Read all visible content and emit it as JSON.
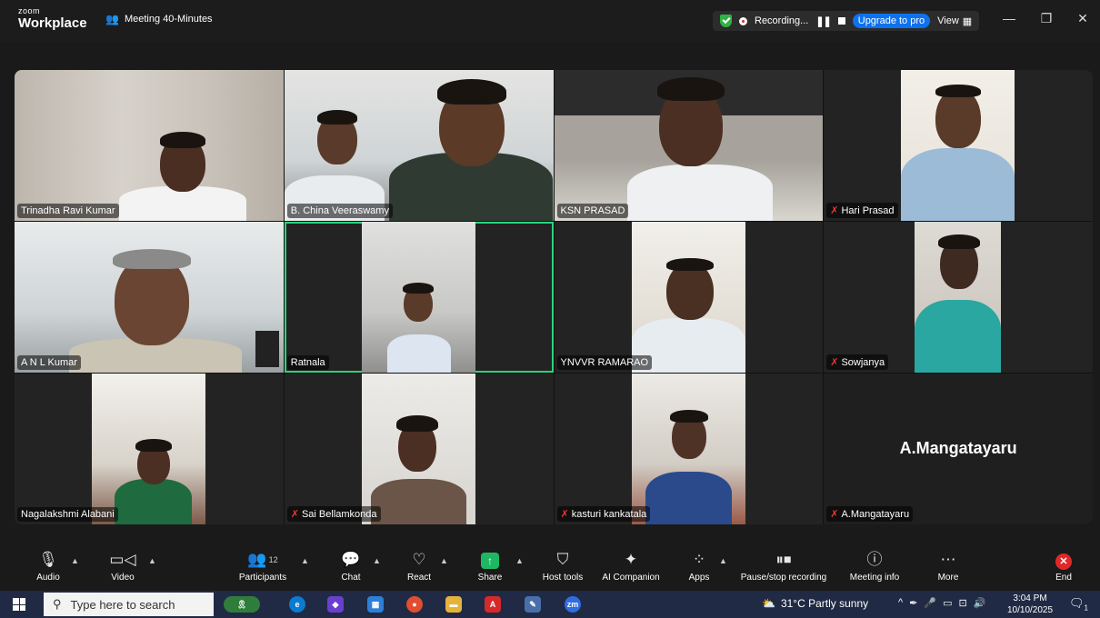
{
  "app": {
    "logo_small": "zoom",
    "logo_main": "Workplace"
  },
  "meeting": {
    "title": "Meeting 40-Minutes"
  },
  "status": {
    "recording": "Recording...",
    "upgrade": "Upgrade to pro",
    "view": "View"
  },
  "participants": [
    {
      "name": "Trinadha Ravi Kumar",
      "muted": false,
      "mic": ""
    },
    {
      "name": "B. China Veeraswamy",
      "muted": false,
      "mic": ""
    },
    {
      "name": "KSN PRASAD",
      "muted": false,
      "mic": ""
    },
    {
      "name": "Hari Prasad",
      "muted": true,
      "mic": "🎤"
    },
    {
      "name": "A N L Kumar",
      "muted": false,
      "mic": ""
    },
    {
      "name": "Ratnala",
      "muted": false,
      "mic": ""
    },
    {
      "name": "YNVVR RAMARAO",
      "muted": false,
      "mic": ""
    },
    {
      "name": "Sowjanya",
      "muted": true,
      "mic": "🎤"
    },
    {
      "name": "Nagalakshmi Alabani",
      "muted": false,
      "mic": ""
    },
    {
      "name": "Sai Bellamkonda",
      "muted": true,
      "mic": "🎤"
    },
    {
      "name": "kasturi kankatala",
      "muted": true,
      "mic": "🎤"
    },
    {
      "name": "A.Mangatayaru",
      "muted": true,
      "mic": "🎤",
      "display_name": "A.Mangatayaru"
    }
  ],
  "toolbar": {
    "audio": "Audio",
    "video": "Video",
    "participants": "Participants",
    "participants_count": "12",
    "chat": "Chat",
    "react": "React",
    "share": "Share",
    "host_tools": "Host tools",
    "ai_companion": "AI Companion",
    "apps": "Apps",
    "pause_stop": "Pause/stop recording",
    "meeting_info": "Meeting info",
    "more": "More",
    "end": "End"
  },
  "taskbar": {
    "search_placeholder": "Type here to search",
    "weather": "31°C  Partly sunny",
    "time": "3:04 PM",
    "date": "10/10/2025",
    "notifications": "1"
  },
  "icons": {
    "accent": "#0e72ed",
    "active_border": "#2bd47c",
    "share_green": "#1fb862",
    "end_red": "#e02828"
  }
}
